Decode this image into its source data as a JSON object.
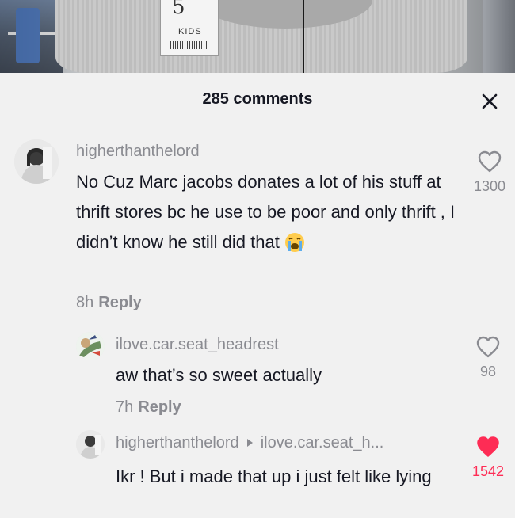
{
  "photo": {
    "tag_size": "5",
    "tag_text": "KIDS"
  },
  "header": {
    "comment_count": "285 comments",
    "close_icon": "close-icon"
  },
  "comments": [
    {
      "username": "higherthanthelord",
      "text": "No Cuz Marc jacobs donates a lot of his stuff at thrift stores bc he use to be poor and only thrift , I didn’t know he still did that",
      "emoji": "loudly-crying-face",
      "time": "8h",
      "reply_label": "Reply",
      "likes": "1300",
      "liked": false
    }
  ],
  "replies": [
    {
      "username": "ilove.car.seat_headrest",
      "text": "aw that’s so sweet actually",
      "time": "7h",
      "reply_label": "Reply",
      "likes": "98",
      "liked": false
    },
    {
      "username": "higherthanthelord",
      "reply_to": "ilove.car.seat_h...",
      "text": "Ikr ! But i made that up i just felt like lying",
      "likes": "1542",
      "liked": true,
      "like_color": "#fe2c55"
    }
  ]
}
